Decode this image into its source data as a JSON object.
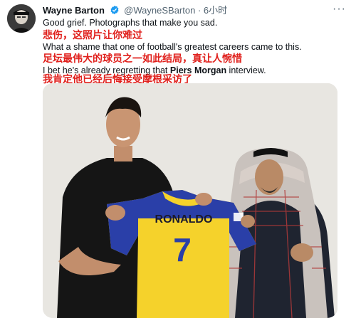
{
  "tweet": {
    "display_name": "Wayne Barton",
    "handle": "@WayneSBarton",
    "separator": "·",
    "time": "6小时",
    "more_label": "···",
    "lines": [
      {
        "type": "en",
        "text": "Good grief. Photographs that make you sad."
      },
      {
        "type": "cn",
        "text": "悲伤，这照片让你难过"
      },
      {
        "type": "en",
        "text": "What a shame that one of football's greatest careers came to this."
      },
      {
        "type": "cn",
        "text": "足坛最伟大的球员之一如此结局，真让人惋惜"
      }
    ],
    "line5": {
      "before": "I bet he's already regretting that ",
      "mention": "Piers Morgan",
      "after": " interview."
    },
    "line6": "我肯定他已经后悔接受摩根采访了"
  },
  "photo": {
    "jersey_name": "RONALDO",
    "jersey_number": "7"
  },
  "colors": {
    "accent_blue": "#1d9bf0",
    "translation_red": "#e0201c",
    "jersey_yellow": "#f5d22b",
    "jersey_blue": "#2a3fa8"
  },
  "icons": {
    "verified": "verified-badge-icon",
    "more": "more-options-icon"
  }
}
